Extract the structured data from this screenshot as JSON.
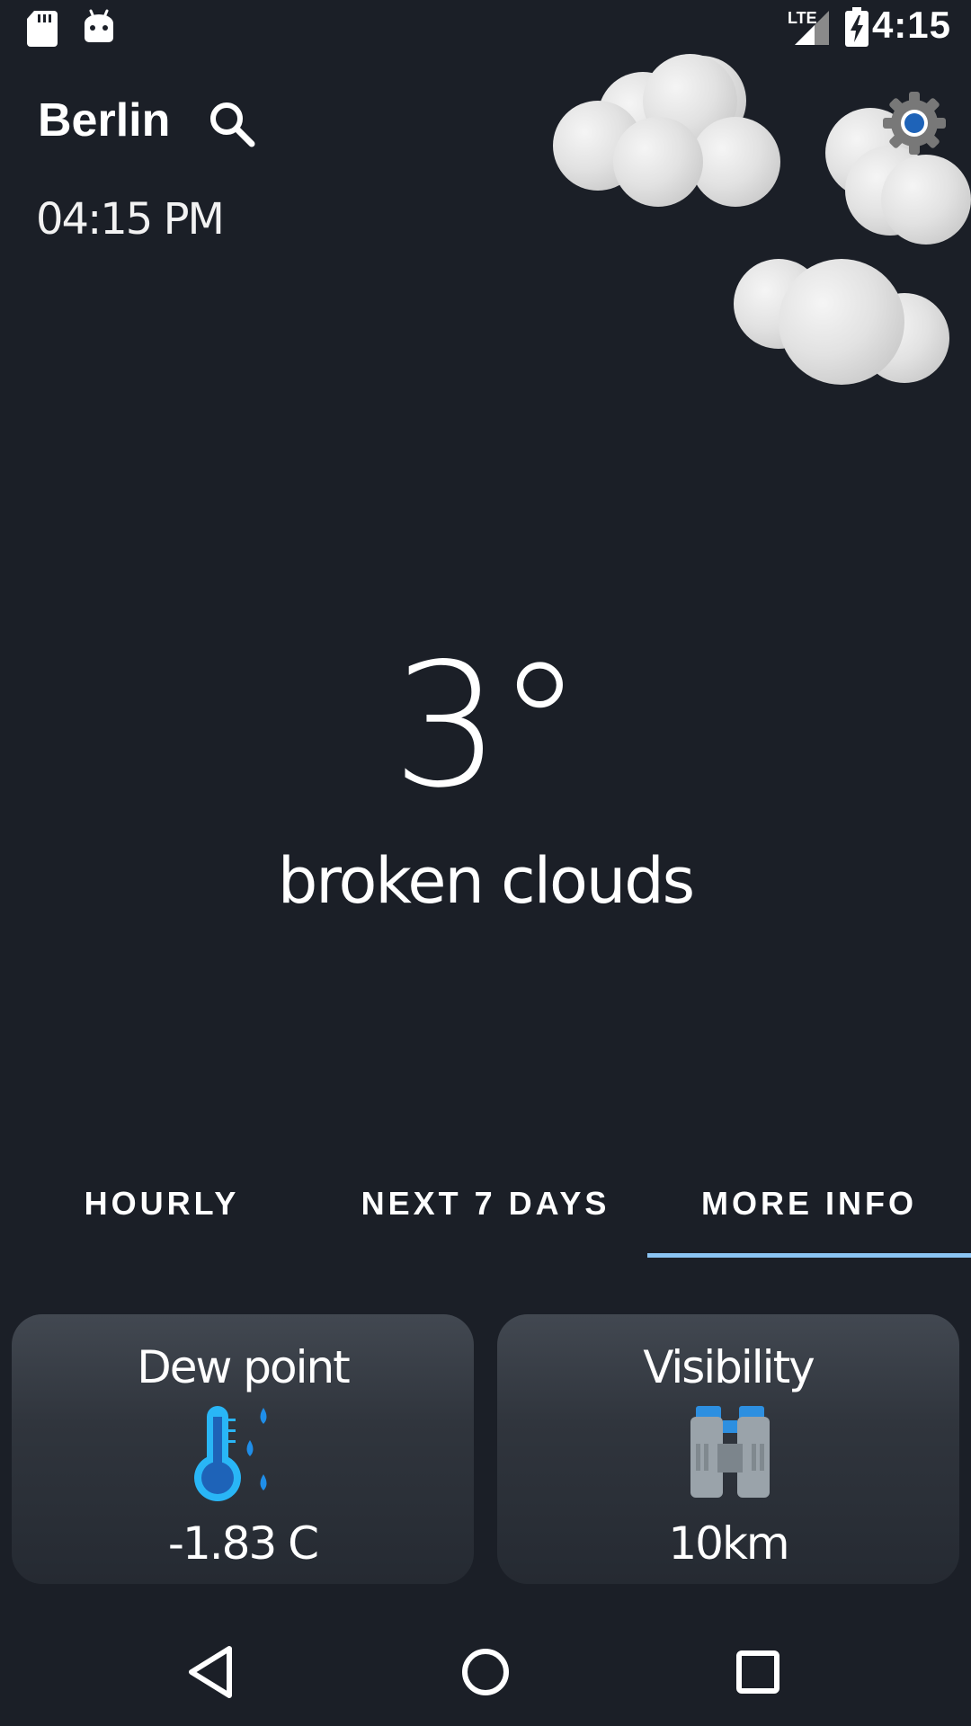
{
  "status_bar": {
    "time": "4:15",
    "network": "LTE",
    "notification_icons": [
      "sd-card-icon",
      "android-icon"
    ],
    "system_icons": [
      "lte-signal-icon",
      "battery-charging-icon"
    ]
  },
  "header": {
    "city": "Berlin",
    "time": "04:15 PM",
    "search_icon": "search-icon",
    "settings_icon": "gear-icon"
  },
  "weather": {
    "temperature": "3°",
    "description": "broken clouds",
    "condition_icon": "clouds-icon"
  },
  "tabs": [
    {
      "label": "HOURLY",
      "selected": false
    },
    {
      "label": "NEXT 7 DAYS",
      "selected": false
    },
    {
      "label": "MORE INFO",
      "selected": true
    }
  ],
  "cards": [
    {
      "title": "Dew point",
      "value": "-1.83 C",
      "icon": "thermometer-drops-icon"
    },
    {
      "title": "Visibility",
      "value": "10km",
      "icon": "binoculars-icon"
    }
  ],
  "nav": {
    "back_icon": "back-icon",
    "home_icon": "home-icon",
    "recents_icon": "recents-icon"
  },
  "colors": {
    "background": "#1b1f27",
    "tab_indicator": "#8bc4f3",
    "accent_blue": "#2f8de4",
    "thermometer_blue": "#29b6f6"
  }
}
